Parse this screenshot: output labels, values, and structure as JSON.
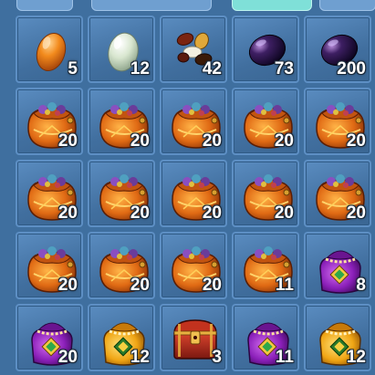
{
  "tabs": [
    {
      "name": "tab-1",
      "active": false
    },
    {
      "name": "tab-2",
      "active": false
    },
    {
      "name": "tab-3",
      "active": true
    },
    {
      "name": "tab-4",
      "active": false
    }
  ],
  "slots": [
    {
      "icon": "orange-egg-icon",
      "count": "5"
    },
    {
      "icon": "pale-green-egg-icon",
      "count": "12"
    },
    {
      "icon": "mixed-seeds-icon",
      "count": "42"
    },
    {
      "icon": "purple-egg-icon",
      "count": "73"
    },
    {
      "icon": "purple-egg-icon",
      "count": "200"
    },
    {
      "icon": "orange-treasure-bag-icon",
      "count": "20"
    },
    {
      "icon": "orange-treasure-bag-icon",
      "count": "20"
    },
    {
      "icon": "orange-treasure-bag-icon",
      "count": "20"
    },
    {
      "icon": "orange-treasure-bag-icon",
      "count": "20"
    },
    {
      "icon": "orange-treasure-bag-icon",
      "count": "20"
    },
    {
      "icon": "orange-treasure-bag-icon",
      "count": "20"
    },
    {
      "icon": "orange-treasure-bag-icon",
      "count": "20"
    },
    {
      "icon": "orange-treasure-bag-icon",
      "count": "20"
    },
    {
      "icon": "orange-treasure-bag-icon",
      "count": "20"
    },
    {
      "icon": "orange-treasure-bag-icon",
      "count": "20"
    },
    {
      "icon": "orange-treasure-bag-icon",
      "count": "20"
    },
    {
      "icon": "orange-treasure-bag-icon",
      "count": "20"
    },
    {
      "icon": "orange-treasure-bag-icon",
      "count": "20"
    },
    {
      "icon": "orange-treasure-bag-icon",
      "count": "11"
    },
    {
      "icon": "purple-gem-pouch-icon",
      "count": "8"
    },
    {
      "icon": "purple-gem-pouch-icon",
      "count": "20"
    },
    {
      "icon": "gold-gem-pouch-icon",
      "count": "12"
    },
    {
      "icon": "red-treasure-chest-icon",
      "count": "3"
    },
    {
      "icon": "purple-gem-pouch-icon",
      "count": "11"
    },
    {
      "icon": "gold-gem-pouch-icon",
      "count": "12"
    }
  ],
  "colors": {
    "panel_bg": "#3f6f9f",
    "slot_border": "#5d8fc4",
    "active_tab": "#7fe0d8"
  }
}
